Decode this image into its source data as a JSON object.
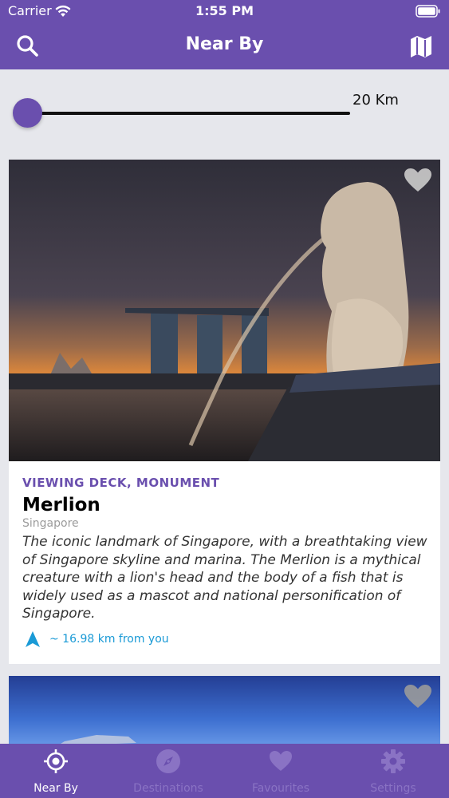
{
  "status_bar": {
    "carrier": "Carrier",
    "time": "1:55 PM"
  },
  "nav": {
    "title": "Near By",
    "left_icon": "search-icon",
    "right_icon": "map-icon"
  },
  "filter": {
    "distance_label": "20 Km",
    "slider_fraction": 0.0
  },
  "cards": [
    {
      "category": "VIEWING DECK, MONUMENT",
      "name": "Merlion",
      "region": "Singapore",
      "description": "The iconic landmark of Singapore, with a breathtaking view of Singapore skyline and marina. The Merlion is a mythical creature with a lion's head and the body of a fish that is widely used as a mascot and national personification of Singapore.",
      "distance": "~ 16.98 km from you",
      "favourite_icon": "heart-icon"
    }
  ],
  "tabs": [
    {
      "label": "Near By",
      "icon": "location-target-icon",
      "active": true
    },
    {
      "label": "Destinations",
      "icon": "compass-icon",
      "active": false
    },
    {
      "label": "Favourites",
      "icon": "heart-icon",
      "active": false
    },
    {
      "label": "Settings",
      "icon": "gear-icon",
      "active": false
    }
  ],
  "colors": {
    "brand": "#6a4fae",
    "tab_inactive": "#8a73c4",
    "distance": "#1a9ad6"
  }
}
